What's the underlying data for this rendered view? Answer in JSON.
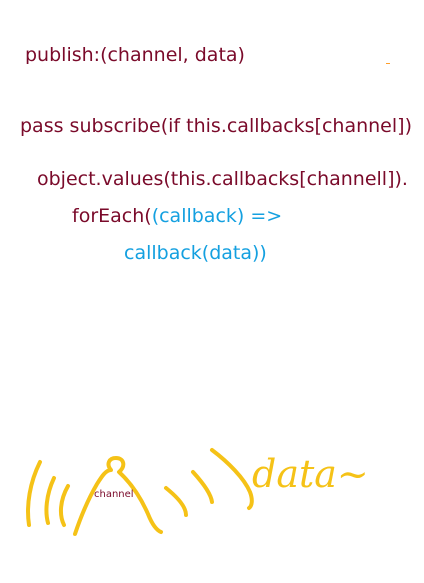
{
  "colors": {
    "code_dark": "#7a0a2a",
    "code_blue": "#14a0e0",
    "ink_yellow": "#f5c217",
    "ink_orange": "#ff9e2a"
  },
  "lines": {
    "l1": "publish:(channel, data)",
    "l2": "pass subscribe(if this.callbacks[channel])",
    "l3": "object.values(this.callbacks[channell]).",
    "l4_dark": "forEach(",
    "l4_blue": "(callback) =>",
    "l5": "callback(data))"
  },
  "sketch": {
    "channel_label": "channel",
    "data_word": "data~"
  }
}
